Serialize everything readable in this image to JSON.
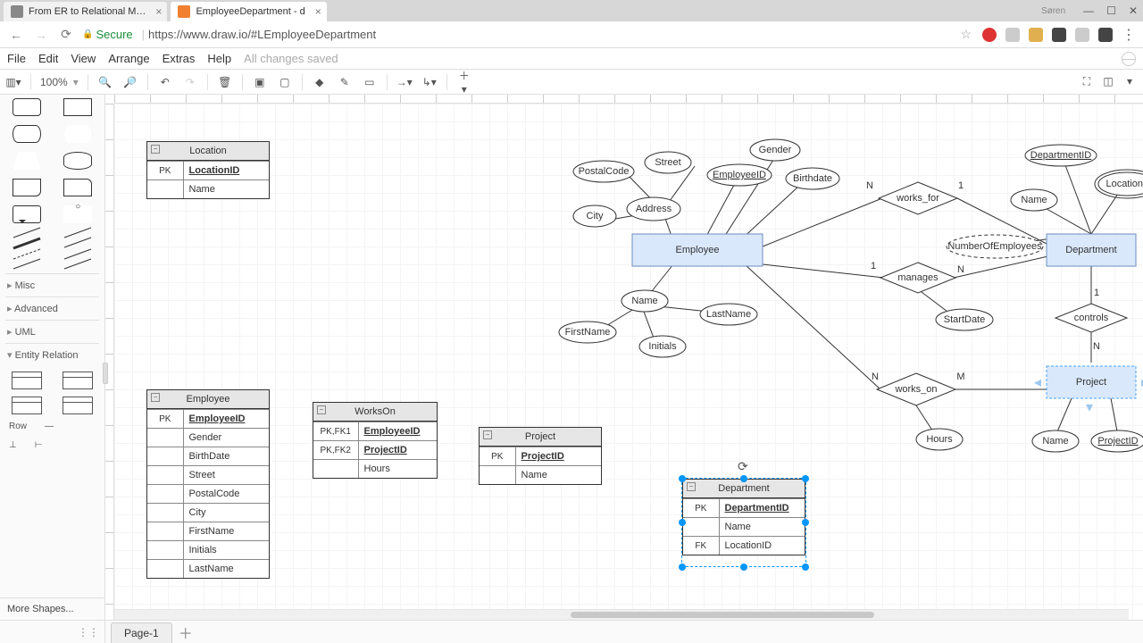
{
  "browser": {
    "tabs": [
      {
        "title": "From ER to Relational M…",
        "active": false
      },
      {
        "title": "EmployeeDepartment - d",
        "active": true
      }
    ],
    "user_label": "Søren",
    "secure_label": "Secure",
    "url_display": "https://www.draw.io/#LEmployeeDepartment"
  },
  "menubar": {
    "items": [
      "File",
      "Edit",
      "View",
      "Arrange",
      "Extras",
      "Help"
    ],
    "status": "All changes saved"
  },
  "toolbar": {
    "zoom_value": "100%"
  },
  "sidebar": {
    "sections": [
      "Misc",
      "Advanced",
      "UML",
      "Entity Relation"
    ],
    "row_label": "Row",
    "more_shapes_label": "More Shapes..."
  },
  "pages": {
    "tab1": "Page-1"
  },
  "er": {
    "entities": {
      "employee": "Employee",
      "department": "Department",
      "project": "Project"
    },
    "relationships": {
      "works_for": "works_for",
      "manages": "manages",
      "controls": "controls",
      "works_on": "works_on"
    },
    "attributes": {
      "employee_id": "EmployeeID",
      "gender": "Gender",
      "birthdate": "Birthdate",
      "address": "Address",
      "postalcode": "PostalCode",
      "street": "Street",
      "city": "City",
      "name": "Name",
      "firstname": "FirstName",
      "lastname": "LastName",
      "initials": "Initials",
      "dept_id": "DepartmentID",
      "dept_name": "Name",
      "locations": "Locations",
      "num_employees": "NumberOfEmployees",
      "startdate": "StartDate",
      "proj_name": "Name",
      "proj_id": "ProjectID",
      "hours": "Hours"
    },
    "cardinalities": {
      "wf_emp": "N",
      "wf_dept": "1",
      "mg_emp": "1",
      "mg_dept": "N",
      "ct_dept": "1",
      "ct_proj": "N",
      "wo_emp": "N",
      "wo_proj": "M"
    }
  },
  "tables": {
    "location": {
      "title": "Location",
      "pk_label": "PK",
      "rows": [
        {
          "key": "PK",
          "name": "LocationID",
          "pk": true
        },
        {
          "key": "",
          "name": "Name"
        }
      ]
    },
    "employee": {
      "title": "Employee",
      "rows": [
        {
          "key": "PK",
          "name": "EmployeeID",
          "pk": true
        },
        {
          "key": "",
          "name": "Gender"
        },
        {
          "key": "",
          "name": "BirthDate"
        },
        {
          "key": "",
          "name": "Street"
        },
        {
          "key": "",
          "name": "PostalCode"
        },
        {
          "key": "",
          "name": "City"
        },
        {
          "key": "",
          "name": "FirstName"
        },
        {
          "key": "",
          "name": "Initials"
        },
        {
          "key": "",
          "name": "LastName"
        }
      ]
    },
    "workson": {
      "title": "WorksOn",
      "rows": [
        {
          "key": "PK,FK1",
          "name": "EmployeeID",
          "pk": true
        },
        {
          "key": "PK,FK2",
          "name": "ProjectID",
          "pk": true
        },
        {
          "key": "",
          "name": "Hours"
        }
      ]
    },
    "project": {
      "title": "Project",
      "rows": [
        {
          "key": "PK",
          "name": "ProjectID",
          "pk": true
        },
        {
          "key": "",
          "name": "Name"
        }
      ]
    },
    "department": {
      "title": "Department",
      "rows": [
        {
          "key": "PK",
          "name": "DepartmentID",
          "pk": true
        },
        {
          "key": "",
          "name": "Name"
        },
        {
          "key": "FK",
          "name": "LocationID"
        }
      ]
    }
  }
}
